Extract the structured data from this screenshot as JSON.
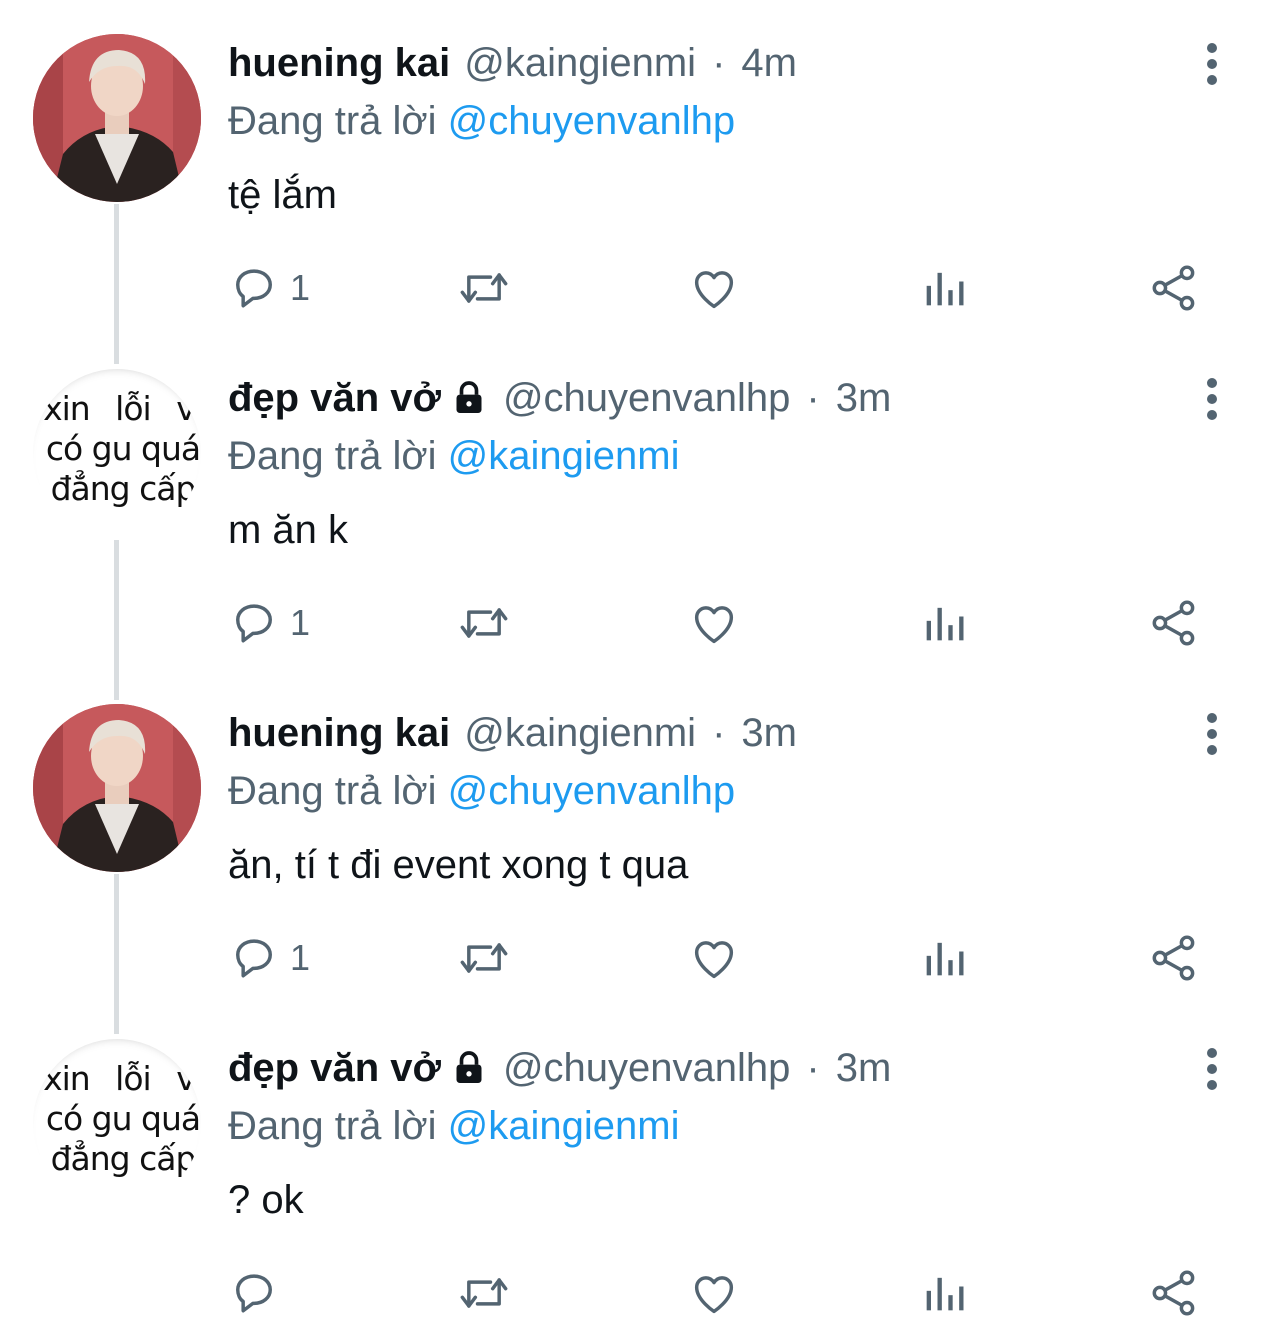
{
  "tweets": [
    {
      "name": "huening kai",
      "handle": "@kaingienmi",
      "separator": "·",
      "time": "4m",
      "replying_prefix": "Đang trả lời",
      "replying_to": "@chuyenvanlhp",
      "text": "tệ lắm",
      "reply_count": "1",
      "avatar": "photo",
      "locked": false
    },
    {
      "name": "đẹp văn vở",
      "handle": "@chuyenvanlhp",
      "separator": "·",
      "time": "3m",
      "replying_prefix": "Đang trả lời",
      "replying_to": "@kaingienmi",
      "text": "m ăn k",
      "reply_count": "1",
      "avatar": "meme",
      "locked": true
    },
    {
      "name": "huening kai",
      "handle": "@kaingienmi",
      "separator": "·",
      "time": "3m",
      "replying_prefix": "Đang trả lời",
      "replying_to": "@chuyenvanlhp",
      "text": "ăn, tí t đi event xong t qua",
      "reply_count": "1",
      "avatar": "photo",
      "locked": false
    },
    {
      "name": "đẹp văn vở",
      "handle": "@chuyenvanlhp",
      "separator": "·",
      "time": "3m",
      "replying_prefix": "Đang trả lời",
      "replying_to": "@kaingienmi",
      "text": "? ok",
      "reply_count": "",
      "avatar": "meme",
      "locked": true
    }
  ],
  "meme_avatar": {
    "lines": [
      "xin lỗi vì",
      "có gu quá",
      "đẳng cấp"
    ]
  },
  "icons": {
    "reply": "reply-icon",
    "retweet": "retweet-icon",
    "like": "heart-icon",
    "views": "views-icon",
    "share": "share-icon",
    "more": "more-vertical-icon",
    "lock": "lock-icon"
  },
  "colors": {
    "text": "#0f1419",
    "secondary": "#536471",
    "mention": "#1d9bf0",
    "thread_line": "#d9dde0"
  }
}
